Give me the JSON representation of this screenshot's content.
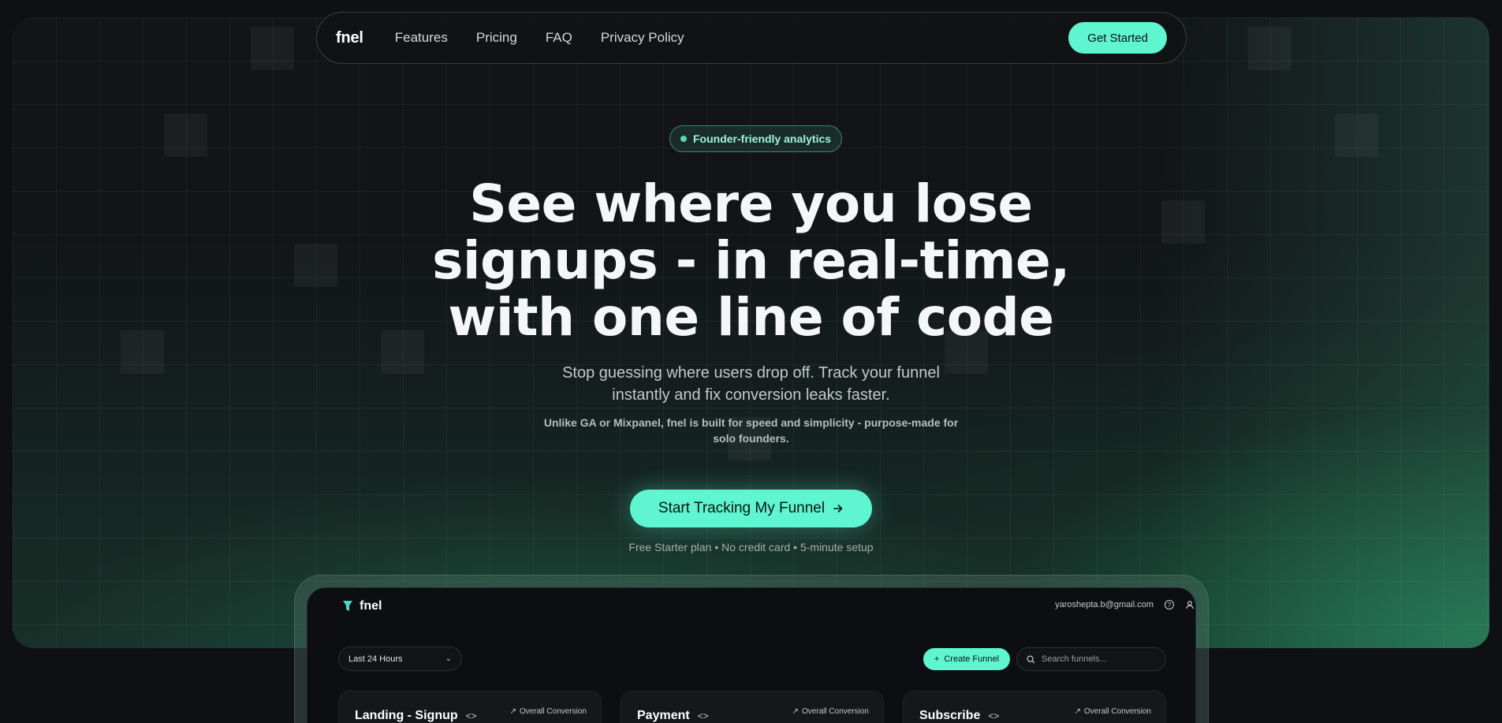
{
  "nav": {
    "logo": "fnel",
    "links": [
      "Features",
      "Pricing",
      "FAQ",
      "Privacy Policy"
    ],
    "cta_label": "Get Started"
  },
  "hero": {
    "badge": "Founder-friendly analytics",
    "headline_lines": [
      "See where you lose",
      "signups - in real-time,",
      "with one line of code"
    ],
    "subheading_lines": [
      "Stop guessing where users drop off. Track your funnel",
      "instantly and fix conversion leaks faster."
    ],
    "detail_lines": [
      "Unlike GA or Mixpanel, fnel is built for speed and simplicity - purpose-made for",
      "solo founders."
    ],
    "cta_label": "Start Tracking My Funnel",
    "cta_icon": "arrow-right-icon",
    "cta_note": "Free Starter plan • No credit card • 5-minute setup"
  },
  "app": {
    "logo": "fnel",
    "user_email": "yaroshepta.b@gmail.com",
    "time_range": "Last 24 Hours",
    "create_label": "Create Funnel",
    "search_placeholder": "Search funnels...",
    "cards": [
      {
        "title": "Landing - Signup",
        "conversion_label": "Overall Conversion"
      },
      {
        "title": "Payment",
        "conversion_label": "Overall Conversion"
      },
      {
        "title": "Subscribe",
        "conversion_label": "Overall Conversion"
      }
    ]
  },
  "colors": {
    "accent": "#5ff5d0",
    "background": "#0e1013"
  }
}
